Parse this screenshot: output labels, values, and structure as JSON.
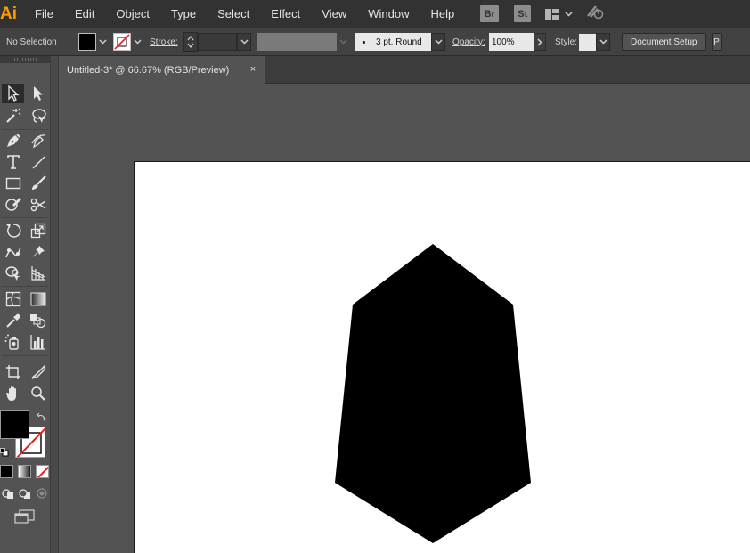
{
  "app": {
    "logo": "Ai"
  },
  "menu": [
    "File",
    "Edit",
    "Object",
    "Type",
    "Select",
    "Effect",
    "View",
    "Window",
    "Help"
  ],
  "menu_buttons": {
    "bridge": "Br",
    "stock": "St"
  },
  "control": {
    "selection_status": "No Selection",
    "stroke_label": "Stroke:",
    "brush": "3 pt. Round",
    "opacity_label": "Opacity:",
    "opacity_value": "100%",
    "style_label": "Style:",
    "document_setup": "Document Setup",
    "preferences_short": "P"
  },
  "document": {
    "tab_title": "Untitled-3* @ 66.67% (RGB/Preview)",
    "close_glyph": "×"
  },
  "colors": {
    "accent": "#ff9a00",
    "ui_dark": "#323232",
    "ui_mid": "#535353",
    "shape_fill": "#000000",
    "artboard": "#ffffff"
  },
  "icons": {
    "toolbox": [
      "selection-tool-icon",
      "direct-selection-tool-icon",
      "magic-wand-tool-icon",
      "lasso-tool-icon",
      "pen-tool-icon",
      "curvature-tool-icon",
      "type-tool-icon",
      "line-segment-tool-icon",
      "rectangle-tool-icon",
      "paintbrush-tool-icon",
      "shaper-tool-icon",
      "scissors-tool-icon",
      "rotate-tool-icon",
      "scale-tool-icon",
      "puppet-warp-tool-icon",
      "pin-tool-icon",
      "shape-builder-tool-icon",
      "perspective-grid-tool-icon",
      "mesh-tool-icon",
      "gradient-tool-icon",
      "eyedropper-tool-icon",
      "blend-tool-icon",
      "symbol-sprayer-tool-icon",
      "column-graph-tool-icon",
      "artboard-tool-icon",
      "slice-tool-icon",
      "hand-tool-icon",
      "zoom-tool-icon"
    ]
  }
}
